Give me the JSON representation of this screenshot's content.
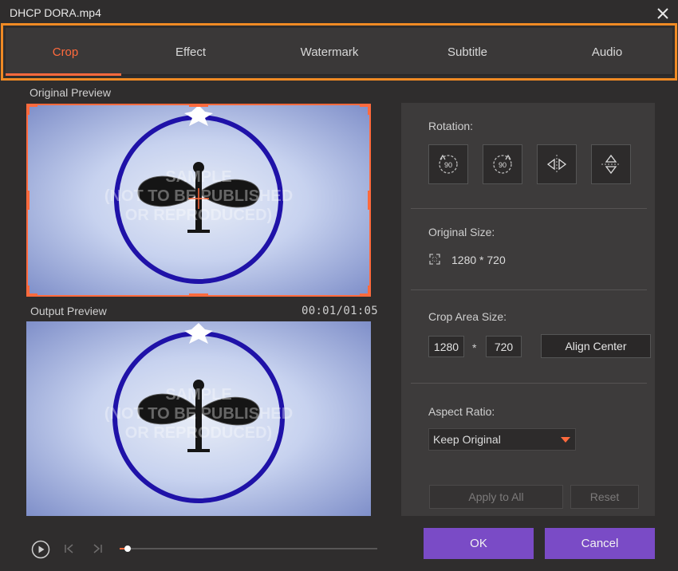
{
  "window": {
    "title": "DHCP DORA.mp4",
    "close_icon": "close-icon"
  },
  "tabs": [
    {
      "label": "Crop",
      "active": true
    },
    {
      "label": "Effect",
      "active": false
    },
    {
      "label": "Watermark",
      "active": false
    },
    {
      "label": "Subtitle",
      "active": false
    },
    {
      "label": "Audio",
      "active": false
    }
  ],
  "preview": {
    "original_label": "Original Preview",
    "output_label": "Output Preview",
    "timecode": "00:01/01:05",
    "watermark_lines": [
      "SAMPLE",
      "(NOT TO BE PUBLISHED",
      "OR REPRODUCED)"
    ]
  },
  "panel": {
    "rotation_label": "Rotation:",
    "rotate_ccw_text": "90",
    "rotate_cw_text": "90",
    "original_size_label": "Original Size:",
    "original_size_value": "1280 * 720",
    "crop_area_label": "Crop Area Size:",
    "crop_width": "1280",
    "crop_sep": "*",
    "crop_height": "720",
    "align_center_label": "Align Center",
    "aspect_ratio_label": "Aspect Ratio:",
    "aspect_ratio_value": "Keep Original",
    "apply_all_label": "Apply to All",
    "reset_label": "Reset"
  },
  "footer": {
    "ok_label": "OK",
    "cancel_label": "Cancel"
  },
  "playback": {
    "progress": 0.015
  },
  "colors": {
    "accent": "#ff6a3d",
    "highlight_border": "#f08a24",
    "primary_button": "#7a4bc6"
  }
}
